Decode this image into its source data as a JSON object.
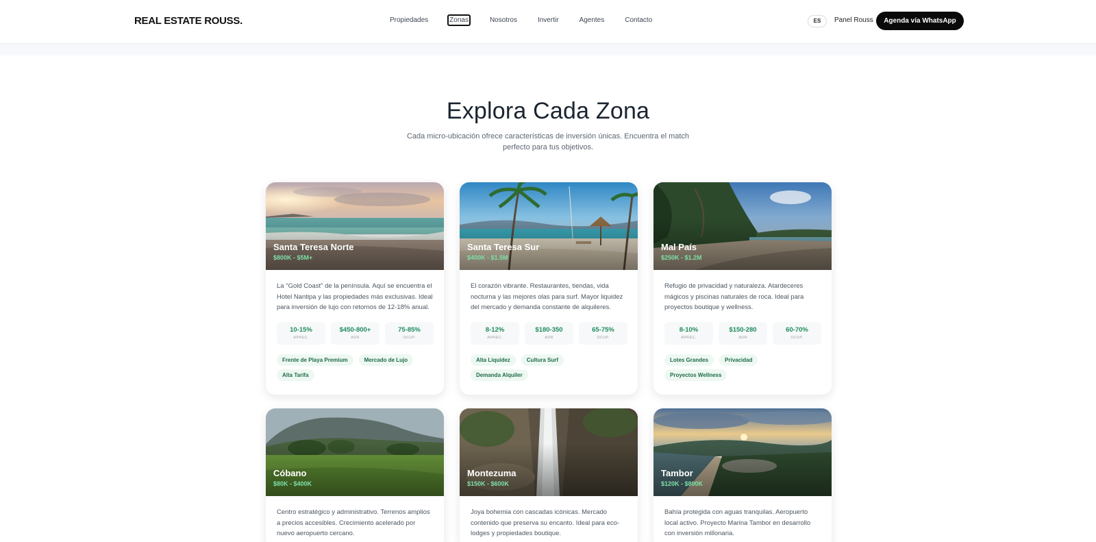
{
  "header": {
    "logo": "REAL ESTATE ROUSS.",
    "nav": [
      "Propiedades",
      "Zonas",
      "Nosotros",
      "Invertir",
      "Agentes",
      "Contacto"
    ],
    "active_nav": "Zonas",
    "lang": "ES",
    "panel_link": "Panel Rouss",
    "cta": "Agenda vía WhatsApp"
  },
  "section": {
    "title": "Explora Cada Zona",
    "subtitle": "Cada micro-ubicación ofrece características de inversión únicas. Encuentra el match perfecto para tus objetivos."
  },
  "stat_labels": [
    "APREC.",
    "ADR",
    "OCUP."
  ],
  "zones": [
    {
      "name": "Santa Teresa Norte",
      "price": "$800K - $5M+",
      "description": "La \"Gold Coast\" de la península. Aquí se encuentra el Hotel Nantipa y las propiedades más exclusivas. Ideal para inversión de lujo con retornos de 12-18% anual.",
      "stats": [
        "10-15%",
        "$450-800+",
        "75-85%"
      ],
      "tags": [
        "Frente de Playa Premium",
        "Mercado de Lujo",
        "Alta Tarifa"
      ],
      "image": "sunset-beach"
    },
    {
      "name": "Santa Teresa Sur",
      "price": "$400K - $1.5M",
      "description": "El corazón vibrante. Restaurantes, tiendas, vida nocturna y las mejores olas para surf. Mayor liquidez del mercado y demanda constante de alquileres.",
      "stats": [
        "8-12%",
        "$180-350",
        "65-75%"
      ],
      "tags": [
        "Alta Liquidez",
        "Cultura Surf",
        "Demanda Alquiler"
      ],
      "image": "palm-beach-umbrella"
    },
    {
      "name": "Mal País",
      "price": "$250K - $1.2M",
      "description": "Refugio de privacidad y naturaleza. Atardeceres mágicos y piscinas naturales de roca. Ideal para proyectos boutique y wellness.",
      "stats": [
        "8-10%",
        "$150-280",
        "60-70%"
      ],
      "tags": [
        "Lotes Grandes",
        "Privacidad",
        "Proyectos Wellness"
      ],
      "image": "jungle-beach"
    },
    {
      "name": "Cóbano",
      "price": "$80K - $400K",
      "description": "Centro estratégico y administrativo. Terrenos amplios a precios accesibles. Crecimiento acelerado por nuevo aeropuerto cercano.",
      "image": "green-valley"
    },
    {
      "name": "Montezuma",
      "price": "$150K - $600K",
      "description": "Joya bohemia con cascadas icónicas. Mercado contenido que preserva su encanto. Ideal para eco-lodges y propiedades boutique.",
      "image": "waterfall"
    },
    {
      "name": "Tambor",
      "price": "$120K - $800K",
      "description": "Bahía protegida con aguas tranquilas. Aeropuerto local activo. Proyecto Marina Tambor en desarrollo con inversión millonaria.",
      "image": "bay-aerial"
    }
  ]
}
